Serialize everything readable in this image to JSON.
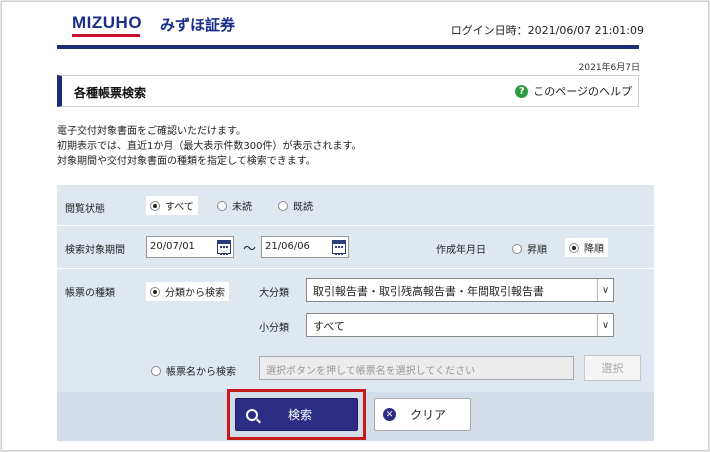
{
  "header": {
    "logo_en": "MIZUHO",
    "logo_jp": "みずほ証券",
    "login_time": "ログイン日時：2021/06/07 21:01:09"
  },
  "page": {
    "date": "2021年6月7日",
    "title": "各種帳票検索",
    "help_label": "このページのヘルプ",
    "description": [
      "電子交付対象書面をご確認いただけます。",
      "初期表示では、直近1か月（最大表示件数300件）が表示されます。",
      "対象期間や交付対象書面の種類を指定して検索できます。"
    ]
  },
  "form": {
    "read_status": {
      "label": "閲覧状態",
      "options": [
        "すべて",
        "未読",
        "既読"
      ],
      "selected": "すべて"
    },
    "period": {
      "label": "検索対象期間",
      "from": "20/07/01",
      "separator": "〜",
      "to": "21/06/06",
      "sort_label": "作成年月日",
      "sort_options": [
        "昇順",
        "降順"
      ],
      "sort_selected": "降順"
    },
    "doc_type": {
      "label": "帳票の種類",
      "by_category_label": "分類から検索",
      "major_label": "大分類",
      "major_value": "取引報告書・取引残高報告書・年間取引報告書",
      "minor_label": "小分類",
      "minor_value": "すべて",
      "by_name_label": "帳票名から検索",
      "name_placeholder": "選択ボタンを押して帳票名を選択してください",
      "choose_label": "選択"
    }
  },
  "buttons": {
    "search": "検索",
    "clear": "クリア"
  },
  "colors": {
    "brand_navy": "#1a2d74",
    "brand_red": "#c8102e",
    "form_bg": "#dfe8f1",
    "search_button": "#2b2e84",
    "highlight": "#c41a1a"
  }
}
